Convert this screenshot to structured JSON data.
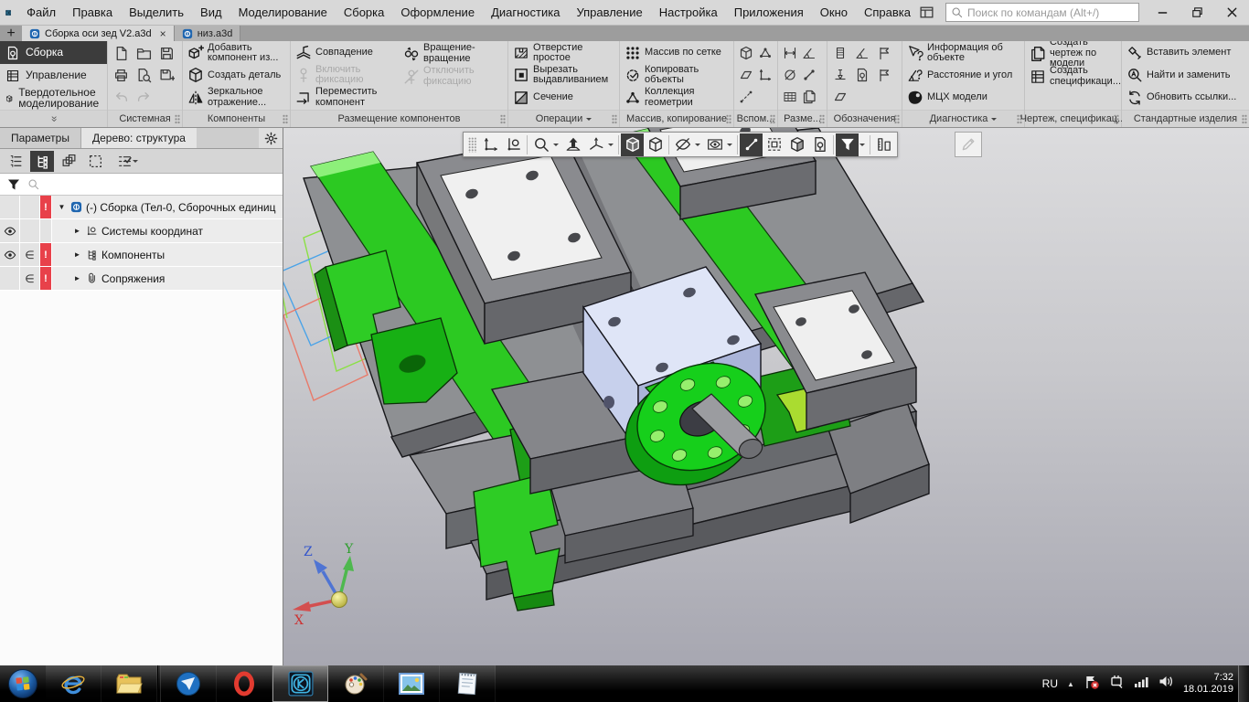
{
  "window": {
    "search_placeholder": "Поиск по командам (Alt+/)"
  },
  "menu": {
    "items": [
      "Файл",
      "Правка",
      "Выделить",
      "Вид",
      "Моделирование",
      "Сборка",
      "Оформление",
      "Диагностика",
      "Управление",
      "Настройка",
      "Приложения",
      "Окно",
      "Справка"
    ]
  },
  "tabs": {
    "add": "+",
    "doc1": {
      "title": "Сборка оси зед V2.a3d",
      "close": "×"
    },
    "doc2": {
      "title": "низ.a3d"
    }
  },
  "ribbon": {
    "modes": {
      "assembly": "Сборка",
      "management": "Управление",
      "solid": "Твердотельное моделирование"
    },
    "groups": {
      "system": {
        "label": "Системная"
      },
      "components": {
        "label": "Компоненты",
        "b1": "Добавить компонент из...",
        "b2": "Создать деталь",
        "b3": "Зеркальное отражение..."
      },
      "placement": {
        "label": "Размещение компонентов",
        "b1": "Совпадение",
        "b2": "Включить фиксацию",
        "b3": "Переместить компонент",
        "b4": "Вращение-вращение",
        "b5": "Отключить фиксацию"
      },
      "operations": {
        "label": "Операции",
        "b1": "Отверстие простое",
        "b2": "Вырезать выдавливанием",
        "b3": "Сечение"
      },
      "array": {
        "label": "Массив, копирование",
        "b1": "Массив по сетке",
        "b2": "Копировать объекты",
        "b3": "Коллекция геометрии"
      },
      "aux": {
        "label": "Вспом..."
      },
      "dims": {
        "label": "Разме..."
      },
      "notation": {
        "label": "Обозначения"
      },
      "diagnostics": {
        "label": "Диагностика",
        "b1": "Информация об объекте",
        "b2": "Расстояние и угол",
        "b3": "МЦХ модели"
      },
      "drawing": {
        "label": "Чертеж, спецификац...",
        "b1": "Создать чертеж по модели",
        "b2": "Создать спецификаци..."
      },
      "standard": {
        "label": "Стандартные изделия",
        "b1": "Вставить элемент",
        "b2": "Найти и заменить",
        "b3": "Обновить ссылки..."
      }
    }
  },
  "panel": {
    "tab_params": "Параметры",
    "tab_tree": "Дерево: структура",
    "tree": {
      "root": "(-) Сборка (Тел-0, Сборочных единиц",
      "cs": "Системы координат",
      "components": "Компоненты",
      "mates": "Сопряжения"
    },
    "marks": {
      "warn": "!",
      "member": "∈",
      "open": "▼",
      "closed": "►"
    }
  },
  "viewport": {
    "triad": {
      "x": "X",
      "y": "Y",
      "z": "Z"
    }
  },
  "taskbar": {
    "lang": "RU",
    "time": "7:32",
    "date": "18.01.2019"
  },
  "colors": {
    "selection_dark": "#3c3c3c",
    "warn_red": "#e8414a",
    "rail_green": "#2cc922",
    "flange_green": "#16cf1b",
    "block_lavender": "#dfe5f7",
    "kompas_blue": "#3fb3e0"
  },
  "icons": {
    "app_logo": "kompas-logo",
    "command_search": "magnifier",
    "tree_visibility": "eye",
    "tree_mates": "paperclip",
    "viewport_filter": "funnel",
    "display_mode": "shaded-cube",
    "orientation_triad": "xyz-axes"
  }
}
